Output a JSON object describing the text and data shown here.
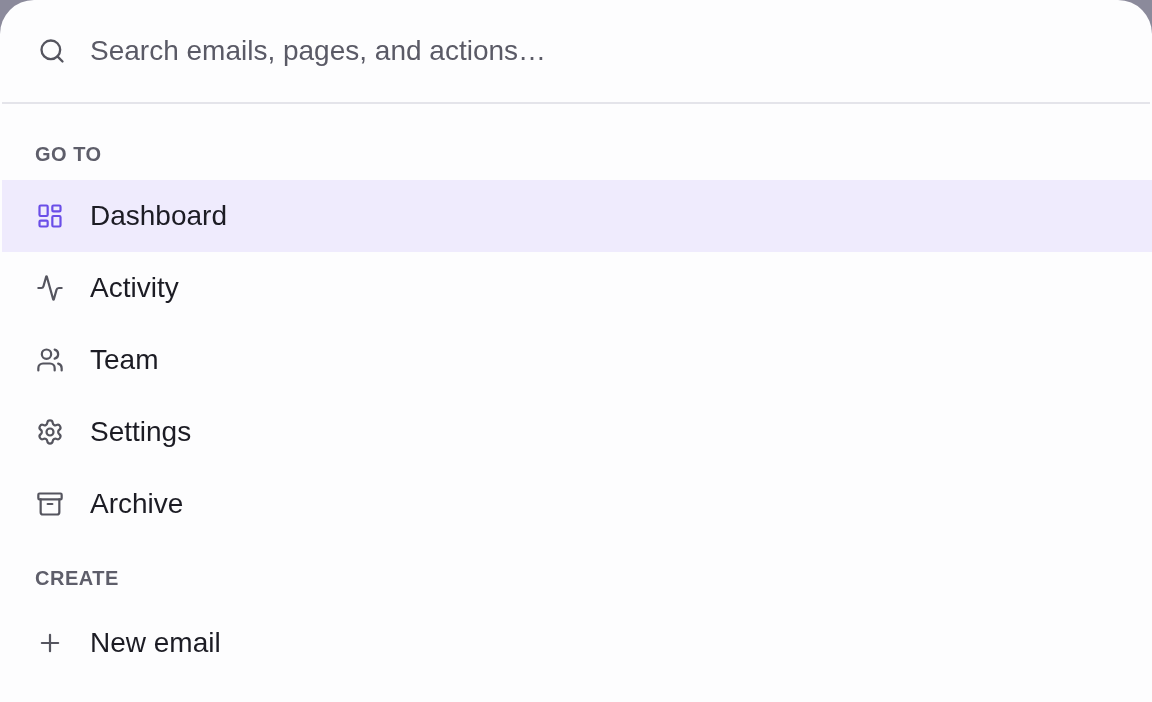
{
  "search": {
    "placeholder": "Search emails, pages, and actions…"
  },
  "sections": [
    {
      "title": "GO TO",
      "items": [
        {
          "label": "Dashboard",
          "selected": true
        },
        {
          "label": "Activity",
          "selected": false
        },
        {
          "label": "Team",
          "selected": false
        },
        {
          "label": "Settings",
          "selected": false
        },
        {
          "label": "Archive",
          "selected": false
        }
      ]
    },
    {
      "title": "CREATE",
      "items": [
        {
          "label": "New email",
          "selected": false
        }
      ]
    }
  ]
}
